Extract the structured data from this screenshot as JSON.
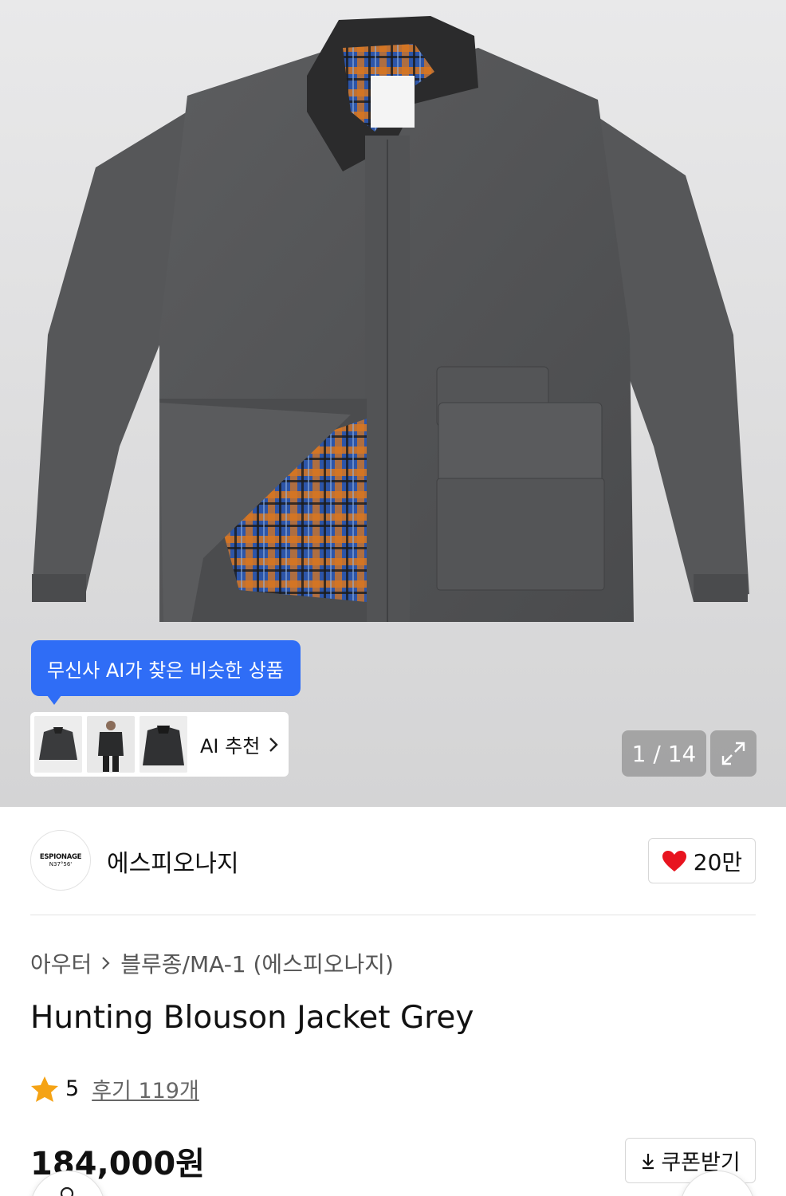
{
  "gallery": {
    "image_alt": "Hunting Blouson Jacket Grey product photo",
    "counter": "1 / 14",
    "ai_tooltip": "무신사 AI가 찾은 비슷한 상품",
    "ai_recommend_label": "AI 추천",
    "icons": {
      "expand": "expand-icon",
      "chevron": "chevron-right-icon"
    }
  },
  "brand": {
    "logo_line1": "ESPIONAGE",
    "logo_line2": "N37°56'",
    "name": "에스피오나지",
    "likes": "20만",
    "like_icon": "heart-icon",
    "like_color": "#e8141f"
  },
  "product": {
    "breadcrumb": [
      "아우터",
      "블루종/MA-1 (에스피오나지)"
    ],
    "title": "Hunting Blouson Jacket Grey",
    "rating": "5",
    "reviews": "후기 119개",
    "price": "184,000원",
    "coupon_label": "쿠폰받기",
    "coupon_icon": "download-icon"
  },
  "colors": {
    "accent": "#2f6df6",
    "star": "#f5a315",
    "heart": "#e8141f"
  }
}
